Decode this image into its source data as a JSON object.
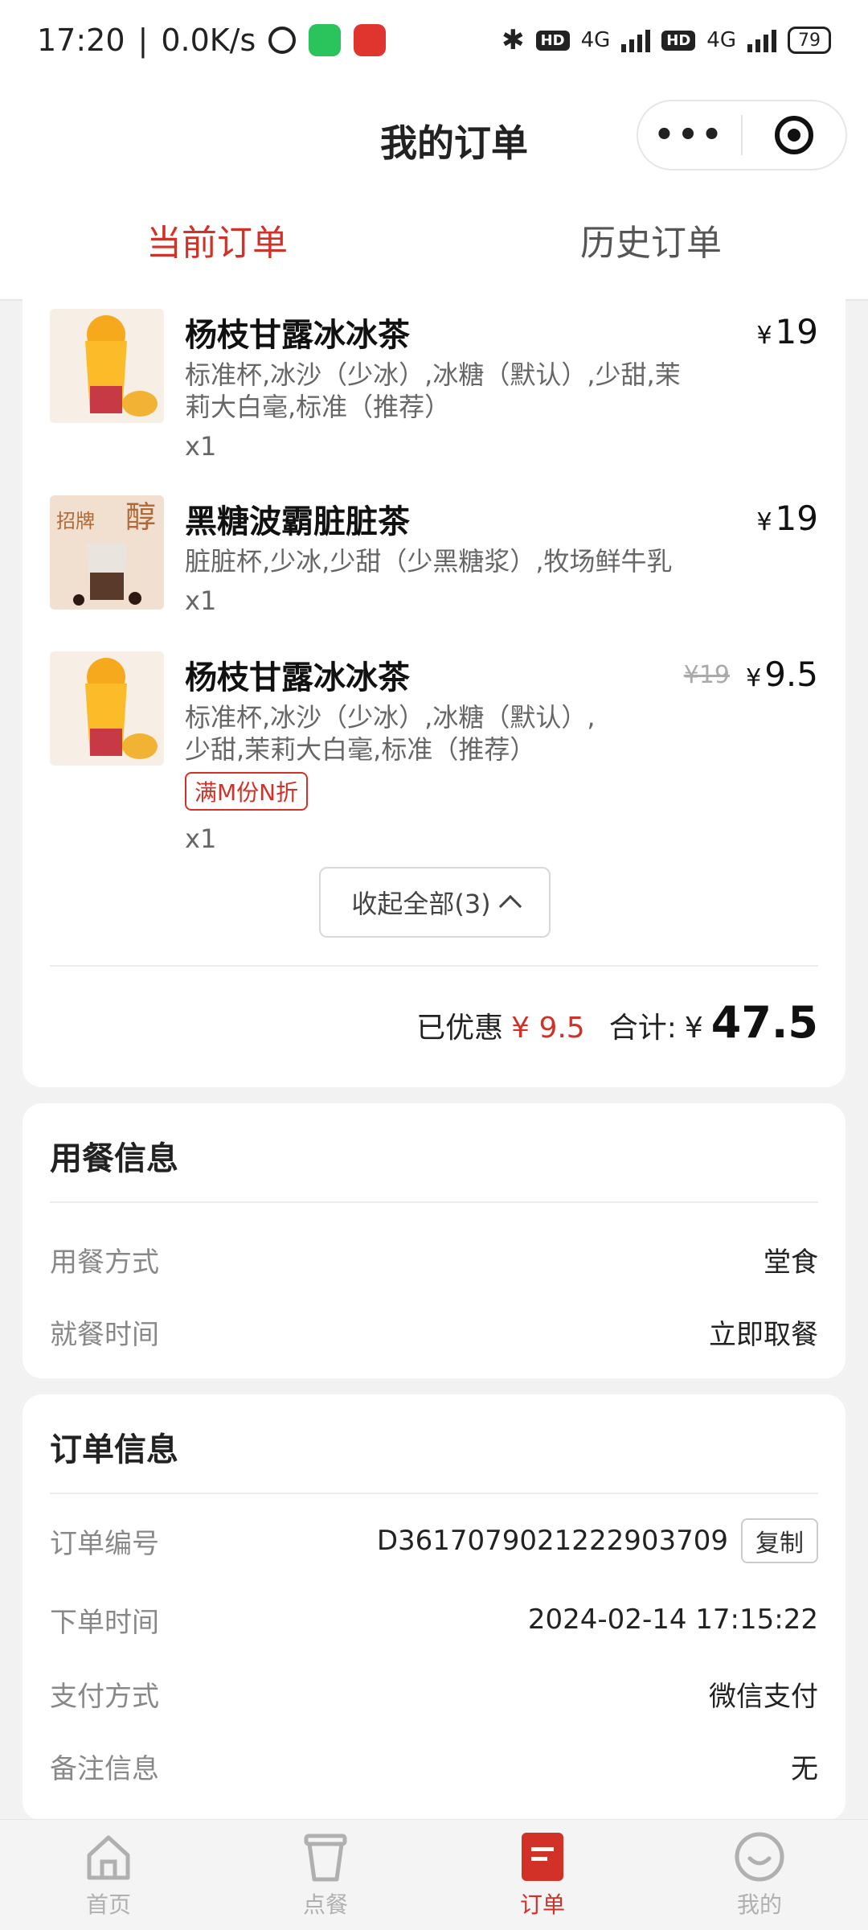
{
  "status_bar": {
    "time": "17:20",
    "speed": "0.0K/s",
    "battery": "79",
    "net1": "4G",
    "net2": "4G",
    "hd": "HD"
  },
  "header": {
    "title": "我的订单",
    "more_label": "•••"
  },
  "tabs": [
    {
      "label": "当前订单",
      "active": true
    },
    {
      "label": "历史订单",
      "active": false
    }
  ],
  "items": [
    {
      "name": "杨枝甘露冰冰茶",
      "spec": "标准杯,冰沙（少冰）,冰糖（默认）,少甜,茉莉大白毫,标准（推荐）",
      "qty": "x1",
      "currency": "¥",
      "price": "19"
    },
    {
      "name": "黑糖波霸脏脏茶",
      "spec": "脏脏杯,少冰,少甜（少黑糖浆）,牧场鲜牛乳",
      "qty": "x1",
      "currency": "¥",
      "price": "19",
      "thumb_text_1": "招牌",
      "thumb_text_2": "醇"
    },
    {
      "name": "杨枝甘露冰冰茶",
      "spec": "标准杯,冰沙（少冰）,冰糖（默认）,少甜,茉莉大白毫,标准（推荐）",
      "qty": "x1",
      "currency": "¥",
      "price": "9.5",
      "old_price": "¥19",
      "promo": "满M份N折"
    }
  ],
  "collapse_label": "收起全部(3)",
  "summary": {
    "discount_label": "已优惠",
    "discount_value": "¥ 9.5",
    "total_label": "合计:",
    "currency": "¥",
    "total_value": "47.5"
  },
  "dining": {
    "title": "用餐信息",
    "rows": [
      {
        "label": "用餐方式",
        "value": "堂食"
      },
      {
        "label": "就餐时间",
        "value": "立即取餐"
      }
    ]
  },
  "order": {
    "title": "订单信息",
    "rows": [
      {
        "label": "订单编号",
        "value": "D3617079021222903709",
        "button": "复制"
      },
      {
        "label": "下单时间",
        "value": "2024-02-14 17:15:22"
      },
      {
        "label": "支付方式",
        "value": "微信支付"
      },
      {
        "label": "备注信息",
        "value": "无"
      }
    ]
  },
  "tabbar": [
    {
      "label": "首页",
      "icon": "home-icon"
    },
    {
      "label": "点餐",
      "icon": "cup-icon"
    },
    {
      "label": "订单",
      "icon": "order-icon",
      "active": true
    },
    {
      "label": "我的",
      "icon": "profile-icon"
    }
  ],
  "colors": {
    "accent": "#d23128"
  }
}
